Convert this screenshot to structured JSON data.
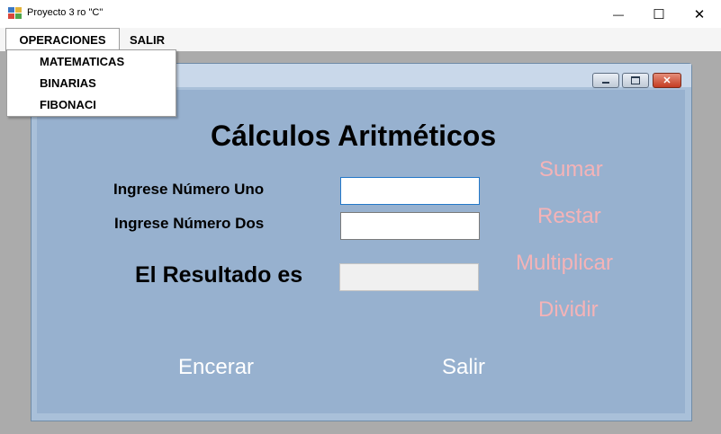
{
  "window": {
    "title": "Proyecto 3 ro \"C\"",
    "minimize_glyph": "—",
    "maximize_glyph": "☐",
    "close_glyph": "✕"
  },
  "menu": {
    "items": [
      {
        "label": "OPERACIONES"
      },
      {
        "label": "SALIR"
      }
    ],
    "dropdown": [
      {
        "label": "MATEMATICAS"
      },
      {
        "label": "BINARIAS"
      },
      {
        "label": "FIBONACI"
      }
    ]
  },
  "child_window": {
    "close_glyph": "✕"
  },
  "form": {
    "heading": "Cálculos Aritméticos",
    "label_num1": "Ingrese Número Uno",
    "label_num2": "Ingrese Número Dos",
    "label_result": "El Resultado es",
    "num1_value": "",
    "num2_value": "",
    "result_value": "",
    "operations": [
      {
        "label": "Sumar"
      },
      {
        "label": "Restar"
      },
      {
        "label": "Multiplicar"
      },
      {
        "label": "Dividir"
      }
    ],
    "clear_label": "Encerar",
    "exit_label": "Salir"
  },
  "colors": {
    "form_background": "#97b1cf",
    "operation_text": "#f5b3b7",
    "bottom_button_text": "#ffffff"
  }
}
